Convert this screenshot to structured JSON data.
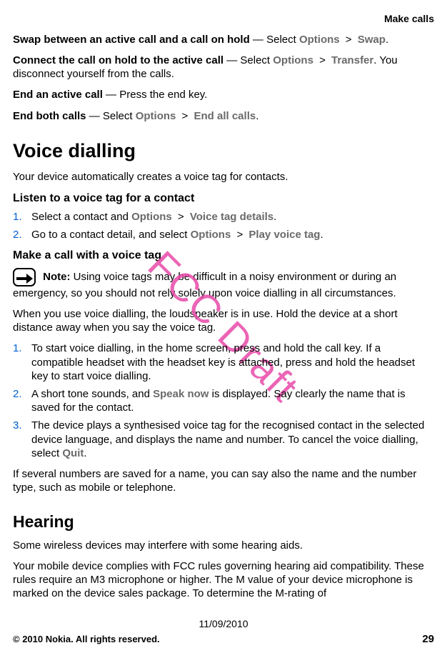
{
  "running_header": "Make calls",
  "intro": [
    {
      "bold": "Swap between an active call and a call on hold",
      "dash": " —  ",
      "t1": "Select ",
      "m1": "Options",
      "sep1": "  >  ",
      "m2": "Swap",
      "t2": "."
    },
    {
      "bold": "Connect the call on hold to the active call",
      "dash": " —  ",
      "t1": "Select ",
      "m1": "Options",
      "sep1": "  >  ",
      "m2": "Transfer",
      "t2": ". You disconnect yourself from the calls."
    },
    {
      "bold": "End an active call",
      "dash": " —  ",
      "t1": "Press the end key.",
      "m1": "",
      "sep1": "",
      "m2": "",
      "t2": ""
    },
    {
      "bold": "End both calls",
      "dash": " —  ",
      "t1": "Select ",
      "m1": "Options",
      "sep1": "  >  ",
      "m2": "End all calls",
      "t2": "."
    }
  ],
  "section_voice": {
    "title": "Voice dialling",
    "lead": "Your device automatically creates a voice tag for contacts.",
    "subhead1": "Listen to a voice tag for a contact",
    "list1": [
      {
        "n": "1.",
        "t1": "Select a contact and ",
        "m1": "Options",
        "sep1": "  >  ",
        "m2": "Voice tag details",
        "t2": "."
      },
      {
        "n": "2.",
        "t1": "Go to a contact detail, and select ",
        "m1": "Options",
        "sep1": "  >  ",
        "m2": "Play voice tag",
        "t2": "."
      }
    ],
    "subhead2": "Make a call with a voice tag",
    "note_label": "Note:",
    "note_text": "  Using voice tags may be difficult in a noisy environment or during an emergency, so you should not rely solely upon voice dialling in all circumstances.",
    "loud_para": "When you use voice dialling, the loudspeaker is in use. Hold the device at a short distance away when you say the voice tag.",
    "list2": [
      {
        "n": "1.",
        "pre": "To start voice dialling, in the home screen, press and hold the call key. If a compatible headset with the headset key is attached, press and hold the headset key to start voice dialling.",
        "m": "",
        "post": ""
      },
      {
        "n": "2.",
        "pre": "A short tone sounds, and ",
        "m": "Speak now",
        "post": " is displayed. Say clearly the name that is saved for the contact."
      },
      {
        "n": "3.",
        "pre": "The device plays a synthesised voice tag for the recognised contact in the selected device language, and displays the name and number. To cancel the voice dialling, select ",
        "m": "Quit",
        "post": "."
      }
    ],
    "tail": "If several numbers are saved for a name, you can say also the name and the number type, such as mobile or telephone."
  },
  "section_hearing": {
    "title": "Hearing",
    "p1": "Some wireless devices may interfere with some hearing aids.",
    "p2": "Your mobile device complies with FCC rules governing hearing aid compatibility. These rules require an M3 microphone or higher. The M value of your device microphone is marked on the device sales package. To determine the M-rating of"
  },
  "watermark": "FCC Draft",
  "footer": {
    "date": "11/09/2010",
    "copyright": "© 2010 Nokia. All rights reserved.",
    "page": "29"
  }
}
